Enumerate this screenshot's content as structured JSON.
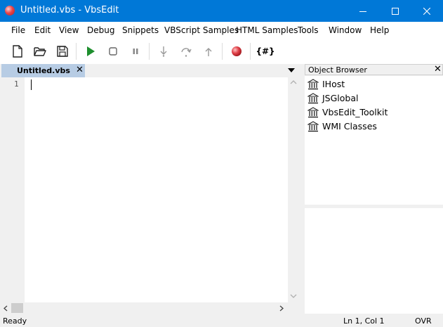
{
  "window": {
    "title": "Untitled.vbs - VbsEdit",
    "controls": {
      "minimize_icon": "minimize-icon",
      "maximize_icon": "maximize-icon",
      "close_icon": "close-icon"
    }
  },
  "menu": [
    "File",
    "Edit",
    "View",
    "Debug",
    "Snippets",
    "VBScript Samples",
    "HTML Samples",
    "Tools",
    "Window",
    "Help"
  ],
  "toolbar": {
    "icons": [
      "new-file-icon",
      "open-folder-icon",
      "save-icon",
      "run-icon",
      "stop-icon",
      "pause-icon",
      "step-into-icon",
      "step-over-icon",
      "step-out-icon",
      "breakpoint-icon"
    ],
    "snippet_label": "{#}"
  },
  "tabs": [
    {
      "label": "Untitled.vbs",
      "active": true
    }
  ],
  "editor": {
    "line_numbers": [
      "1"
    ],
    "content": ""
  },
  "object_browser": {
    "title": "Object Browser",
    "items": [
      "IHost",
      "JSGlobal",
      "VbsEdit_Toolkit",
      "WMI Classes"
    ]
  },
  "status": {
    "left": "Ready",
    "position": "Ln 1, Col 1",
    "mode": "OVR"
  },
  "colors": {
    "titlebar": "#0078d7",
    "tab_active": "#b7cce4",
    "run_green": "#1e8f2e",
    "breakpoint_red": "#d9363e"
  }
}
